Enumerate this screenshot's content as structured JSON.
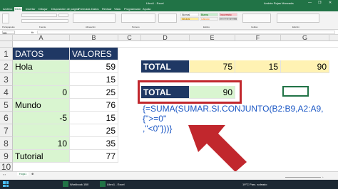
{
  "window": {
    "title": "Libro1 - Excel",
    "user": "Andrés Rojas Moncada",
    "controls": [
      "—",
      "❐",
      "✕"
    ]
  },
  "ribbon_tabs": [
    "Archivo",
    "Inicio",
    "Insertar",
    "Dibujar",
    "Disposición de página",
    "Fórmulas",
    "Datos",
    "Revisar",
    "Vista",
    "Programador",
    "Ayuda"
  ],
  "ribbon": {
    "groups": [
      "Portapapeles",
      "Fuente",
      "Alineación",
      "Número",
      "Estilos",
      "Celdas",
      "Edición"
    ],
    "styles": {
      "row1": [
        "Normal",
        "Buena",
        "Incorrecto"
      ],
      "row2": [
        "Neutral",
        "Cálculo",
        "Celda de co..."
      ]
    },
    "style_colors": [
      "#ffffff",
      "#c6efce",
      "#ffc7ce",
      "#ffeb9c",
      "#f2f2f2",
      "#a5a5a5"
    ]
  },
  "formula_bar": {
    "name_box": "G5",
    "fx": "fx"
  },
  "grid": {
    "columns": [
      "A",
      "B",
      "C",
      "D",
      "E",
      "F",
      "G"
    ],
    "rows": [
      "1",
      "2",
      "3",
      "4",
      "5",
      "6",
      "7",
      "8",
      "9",
      "10"
    ],
    "data_header": [
      "DATOS",
      "VALORES"
    ],
    "data_rows": [
      [
        "Hola",
        "59"
      ],
      [
        "",
        "15"
      ],
      [
        "0",
        "25"
      ],
      [
        "Mundo",
        "76"
      ],
      [
        "-5",
        "15"
      ],
      [
        "",
        "25"
      ],
      [
        "10",
        "35"
      ],
      [
        "Tutorial",
        "77"
      ]
    ],
    "total_row_1": {
      "label": "TOTAL",
      "values": [
        "75",
        "15",
        "90"
      ]
    },
    "total_row_2": {
      "label": "TOTAL",
      "value": "90"
    }
  },
  "formula_display": {
    "line1": "{=SUMA(SUMAR.SI.CONJUNTO(B2:B9,A2:A9,{\">=0\"",
    "line2": ",\"<0\"}))}"
  },
  "colors": {
    "excel_green": "#217346",
    "header_navy": "#1f3864",
    "light_green": "#d9f5d0",
    "light_yellow": "#fff2b3",
    "callout_red": "#c1272d",
    "formula_blue": "#1a56c4"
  },
  "sheet": {
    "tab": "Hoja1"
  },
  "status": {
    "zoom": "+"
  },
  "taskbar": {
    "start_icon": "windows-icon",
    "items": [
      "Workbook 1B0",
      "Libro1 - Excel"
    ],
    "weather": "19°C Parc. soleado"
  }
}
